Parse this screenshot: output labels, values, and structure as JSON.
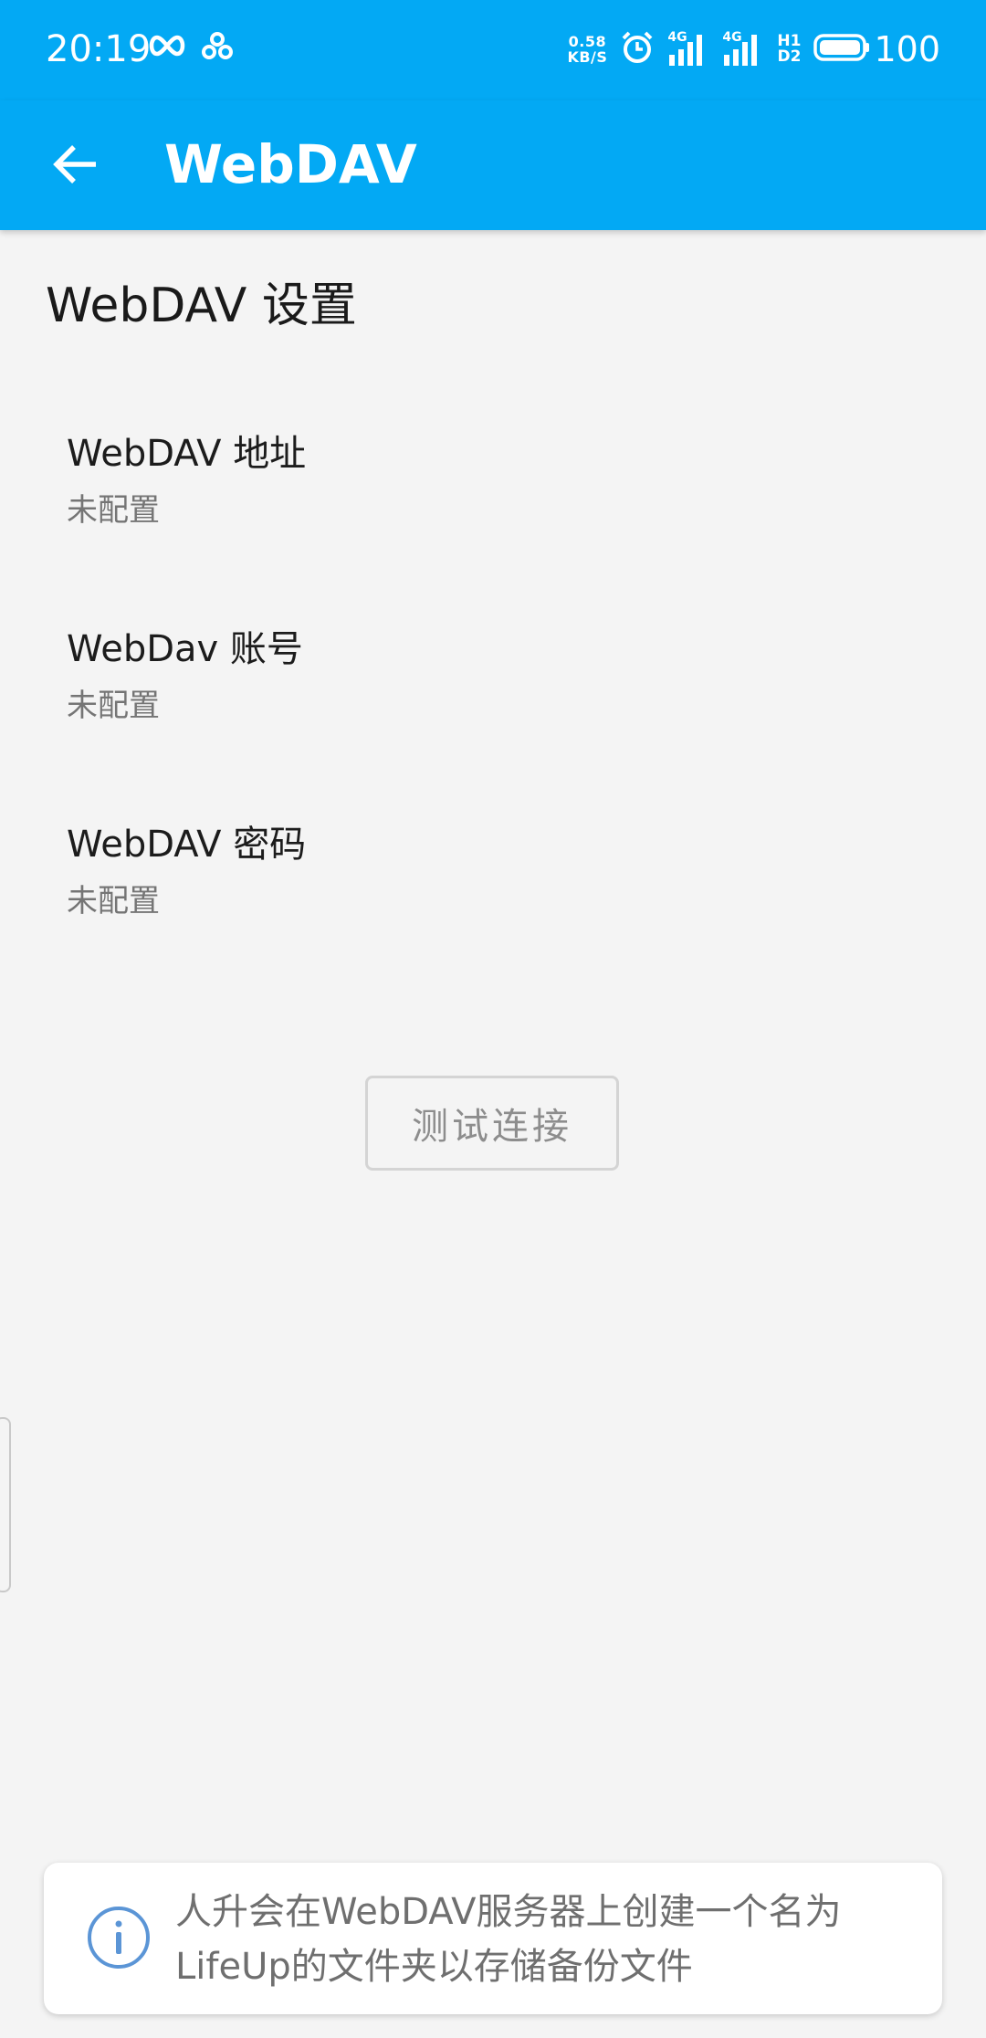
{
  "status_bar": {
    "time": "20:19",
    "net_speed_value": "0.58",
    "net_speed_unit": "KB/S",
    "signal_1_label": "4G",
    "signal_2_label": "4G",
    "hd_top": "H1",
    "hd_bottom": "D2",
    "battery": "100"
  },
  "app_bar": {
    "title": "WebDAV"
  },
  "section": {
    "title": "WebDAV 设置"
  },
  "preferences": [
    {
      "title": "WebDAV 地址",
      "summary": "未配置"
    },
    {
      "title": "WebDav 账号",
      "summary": "未配置"
    },
    {
      "title": "WebDAV 密码",
      "summary": "未配置"
    }
  ],
  "actions": {
    "test_connection": "测试连接"
  },
  "info": {
    "text": "人升会在WebDAV服务器上创建一个名为LifeUp的文件夹以存储备份文件"
  },
  "colors": {
    "primary": "#03a9f4",
    "background": "#f4f4f4",
    "info_icon": "#5b95d6"
  }
}
